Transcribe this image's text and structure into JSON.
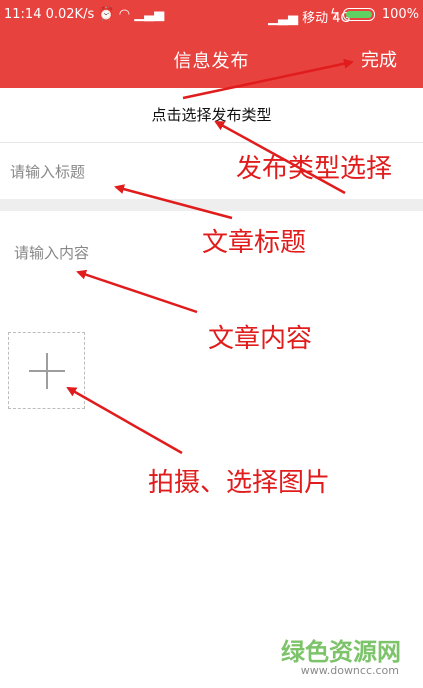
{
  "status_bar": {
    "time": "11:14",
    "speed": "0.02K/s",
    "carrier": "移动 4G",
    "battery": "100%"
  },
  "header": {
    "title": "信息发布",
    "done_label": "完成"
  },
  "form": {
    "type_selector_label": "点击选择发布类型",
    "title_placeholder": "请输入标题",
    "content_placeholder": "请输入内容"
  },
  "annotations": {
    "type_select": "发布类型选择",
    "article_title": "文章标题",
    "article_content": "文章内容",
    "photo": "拍摄、选择图片"
  },
  "watermark": {
    "brand": "绿色资源网",
    "url": "www.downcc.com"
  },
  "colors": {
    "header_red": "#e8423f",
    "annotation_red": "#e01c1c",
    "watermark_green": "#7cc36a"
  }
}
